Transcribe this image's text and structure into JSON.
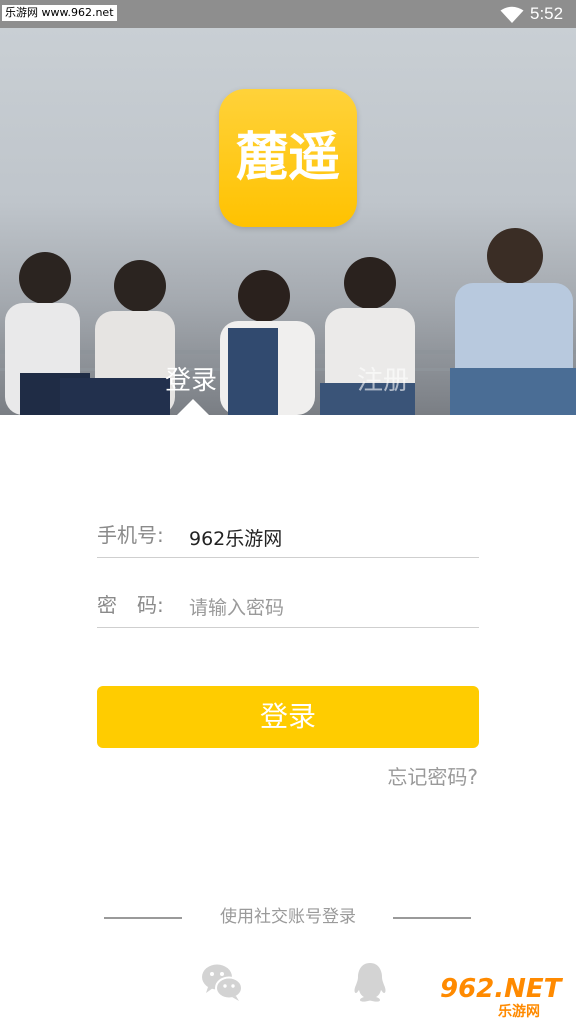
{
  "status_bar": {
    "watermark": "乐游网 www.962.net",
    "time": "5:52",
    "wifi_icon": "wifi-icon"
  },
  "hero": {
    "logo_text": "麓遥",
    "tabs": [
      {
        "label": "登录",
        "active": true
      },
      {
        "label": "注册",
        "active": false
      }
    ]
  },
  "form": {
    "phone": {
      "label": "手机号:",
      "value": "962乐游网"
    },
    "password": {
      "label": "密　码:",
      "placeholder": "请输入密码"
    },
    "login_button": "登录",
    "forgot_password": "忘记密码?"
  },
  "social": {
    "title": "使用社交账号登录",
    "icons": [
      "wechat-icon",
      "qq-icon"
    ]
  },
  "corner_watermark": {
    "brand": "962.NET",
    "sub": "乐游网"
  },
  "colors": {
    "accent": "#ffcc00",
    "text_muted": "#9a9a9a",
    "status_bar": "#8e8e8e"
  }
}
